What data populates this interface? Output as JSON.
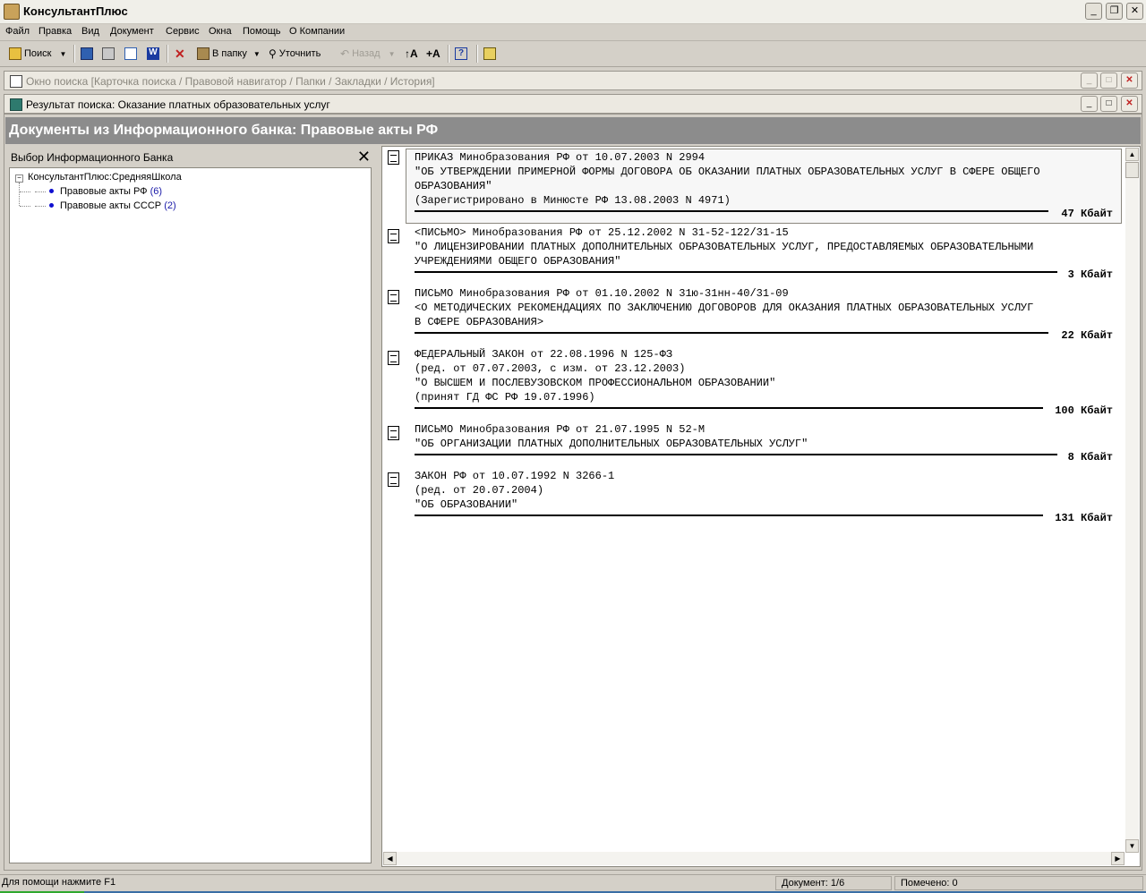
{
  "app": {
    "title": "КонсультантПлюс"
  },
  "menu": [
    "Файл",
    "Правка",
    "Вид",
    "Документ",
    "Сервис",
    "Окна",
    "Помощь",
    "О Компании"
  ],
  "toolbar": {
    "search": "Поиск",
    "to_folder": "В папку",
    "refine": "Уточнить",
    "back": "Назад",
    "font_larger": "↑А",
    "font_smaller": "+А"
  },
  "search_window": {
    "title": "Окно поиска [Карточка поиска / Правовой навигатор / Папки / Закладки / История]"
  },
  "result_window": {
    "title": "Результат поиска: Оказание платных образовательных услуг",
    "header": "Документы из Информационного банка: Правовые акты РФ"
  },
  "bank_panel": {
    "title": "Выбор Информационного Банка",
    "root": "КонсультантПлюс:СредняяШкола",
    "items": [
      {
        "label": "Правовые акты РФ",
        "count": "(6)"
      },
      {
        "label": "Правовые акты СССР",
        "count": "(2)"
      }
    ]
  },
  "documents": [
    {
      "lines": [
        "ПРИКАЗ Минобразования РФ от 10.07.2003 N 2994",
        "\"ОБ УТВЕРЖДЕНИИ ПРИМЕРНОЙ ФОРМЫ ДОГОВОРА ОБ ОКАЗАНИИ ПЛАТНЫХ ОБРАЗОВАТЕЛЬНЫХ УСЛУГ В СФЕРЕ ОБЩЕГО",
        "ОБРАЗОВАНИЯ\"",
        "(Зарегистрировано в Минюсте РФ 13.08.2003 N 4971)"
      ],
      "size": "47 Кбайт"
    },
    {
      "lines": [
        "<ПИСЬМО> Минобразования РФ от 25.12.2002 N 31-52-122/31-15",
        "\"О ЛИЦЕНЗИРОВАНИИ ПЛАТНЫХ ДОПОЛНИТЕЛЬНЫХ ОБРАЗОВАТЕЛЬНЫХ УСЛУГ, ПРЕДОСТАВЛЯЕМЫХ ОБРАЗОВАТЕЛЬНЫМИ",
        "УЧРЕЖДЕНИЯМИ ОБЩЕГО ОБРАЗОВАНИЯ\""
      ],
      "size": "3 Кбайт"
    },
    {
      "lines": [
        "ПИСЬМО Минобразования РФ от 01.10.2002 N 31ю-31нн-40/31-09",
        "<О МЕТОДИЧЕСКИХ РЕКОМЕНДАЦИЯХ ПО ЗАКЛЮЧЕНИЮ ДОГОВОРОВ ДЛЯ ОКАЗАНИЯ ПЛАТНЫХ ОБРАЗОВАТЕЛЬНЫХ УСЛУГ",
        "В СФЕРЕ ОБРАЗОВАНИЯ>"
      ],
      "size": "22 Кбайт"
    },
    {
      "lines": [
        "ФЕДЕРАЛЬНЫЙ ЗАКОН от 22.08.1996 N 125-ФЗ",
        "(ред. от 07.07.2003, с изм. от 23.12.2003)",
        "\"О ВЫСШЕМ И ПОСЛЕВУЗОВСКОМ ПРОФЕССИОНАЛЬНОМ ОБРАЗОВАНИИ\"",
        "(принят ГД ФС РФ 19.07.1996)"
      ],
      "size": "100 Кбайт"
    },
    {
      "lines": [
        "ПИСЬМО Минобразования РФ от 21.07.1995 N 52-М",
        "\"ОБ ОРГАНИЗАЦИИ ПЛАТНЫХ ДОПОЛНИТЕЛЬНЫХ ОБРАЗОВАТЕЛЬНЫХ УСЛУГ\""
      ],
      "size": "8 Кбайт"
    },
    {
      "lines": [
        "ЗАКОН РФ от 10.07.1992 N 3266-1",
        "(ред. от 20.07.2004)",
        "\"ОБ ОБРАЗОВАНИИ\""
      ],
      "size": "131 Кбайт"
    }
  ],
  "status": {
    "hint": "Для помощи нажмите F1",
    "document": "Документ: 1/6",
    "marked": "Помечено: 0"
  }
}
